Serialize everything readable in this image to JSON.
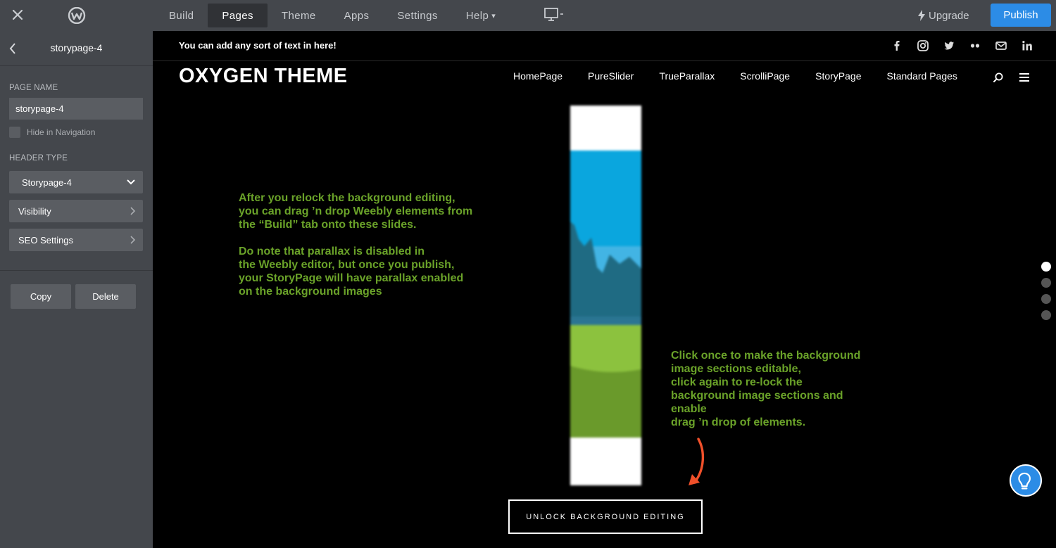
{
  "topbar": {
    "tabs": [
      {
        "label": "Build",
        "active": false,
        "caret": false
      },
      {
        "label": "Pages",
        "active": true,
        "caret": false
      },
      {
        "label": "Theme",
        "active": false,
        "caret": false
      },
      {
        "label": "Apps",
        "active": false,
        "caret": false
      },
      {
        "label": "Settings",
        "active": false,
        "caret": false
      },
      {
        "label": "Help",
        "active": false,
        "caret": true
      }
    ],
    "caret_glyph": "▾",
    "upgrade_label": "Upgrade",
    "publish_label": "Publish",
    "publish_color": "#2c8ce6"
  },
  "sidebar": {
    "title": "storypage-4",
    "page_name_label": "PAGE NAME",
    "page_name_value": "storypage-4",
    "hide_nav_label": "Hide in Navigation",
    "hide_nav_checked": false,
    "header_type_label": "HEADER TYPE",
    "header_type_value": "Storypage-4",
    "visibility_label": "Visibility",
    "seo_label": "SEO Settings",
    "copy_label": "Copy",
    "delete_label": "Delete"
  },
  "site": {
    "announcement": "You can add any sort of text in here!",
    "brand": "OXYGEN THEME",
    "nav": [
      "HomePage",
      "PureSlider",
      "TrueParallax",
      "ScrolliPage",
      "StoryPage",
      "Standard Pages"
    ],
    "social_icons": [
      "facebook-icon",
      "instagram-icon",
      "twitter-icon",
      "flickr-icon",
      "mail-icon",
      "linkedin-icon"
    ],
    "left_text": [
      "After you relock the background editing,",
      "you can drag ’n drop Weebly elements from",
      "the “Build” tab onto these slides.",
      "",
      "Do note that parallax is disabled in",
      "the Weebly editor, but once you publish,",
      "your StoryPage will have parallax enabled",
      "on the background images"
    ],
    "right_text": [
      "Click once to make the background",
      "image sections editable,",
      "click again to re-lock the",
      "background image sections and",
      "enable",
      "drag ’n drop of elements."
    ],
    "text_color": "#6aa229",
    "unlock_label": "UNLOCK BACKGROUND EDITING",
    "slide_dots_active": 0,
    "arrow_color": "#f0502a"
  }
}
